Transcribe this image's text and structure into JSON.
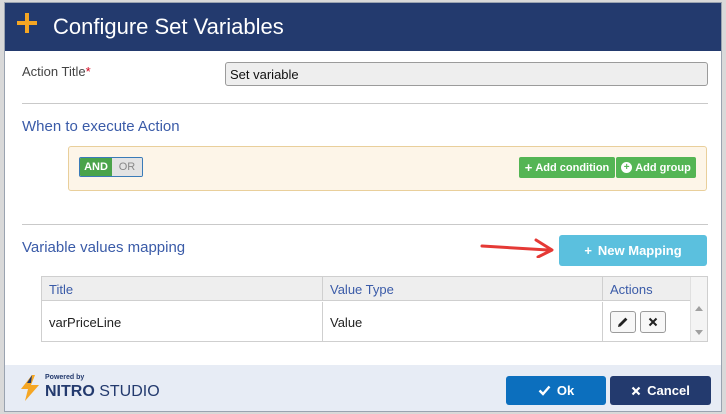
{
  "dialog": {
    "title": "Configure Set Variables"
  },
  "action_title": {
    "label": "Action Title",
    "required_marker": "*",
    "value": "Set variable"
  },
  "when_section": {
    "title": "When to execute Action",
    "toggle_and": "AND",
    "toggle_or": "OR",
    "toggle_selected": "AND",
    "add_condition_label": "Add condition",
    "add_group_label": "Add group"
  },
  "mapping_section": {
    "title": "Variable values mapping",
    "new_mapping_label": "New Mapping",
    "columns": [
      "Title",
      "Value Type",
      "Actions"
    ],
    "rows": [
      {
        "title": "varPriceLine",
        "value_type": "Value"
      }
    ]
  },
  "footer": {
    "powered_by": "Powered by",
    "brand_bold": "NITRO",
    "brand_light": " STUDIO",
    "ok_label": "Ok",
    "cancel_label": "Cancel"
  },
  "colors": {
    "header_bg": "#233a6e",
    "accent_orange": "#f5a623",
    "link_blue": "#3a5ba8",
    "green": "#54b554",
    "new_mapping_bg": "#5bc0de",
    "ok_bg": "#0c6fbe",
    "annotation_arrow": "#e53935"
  },
  "icons": {
    "header": "plus-icon",
    "add_condition": "plus-icon",
    "add_group": "plus-circle-icon",
    "new_mapping": "plus-icon",
    "edit": "pencil-icon",
    "delete": "close-icon",
    "ok": "check-icon",
    "cancel": "close-icon",
    "logo": "lightning-bolt-icon"
  }
}
